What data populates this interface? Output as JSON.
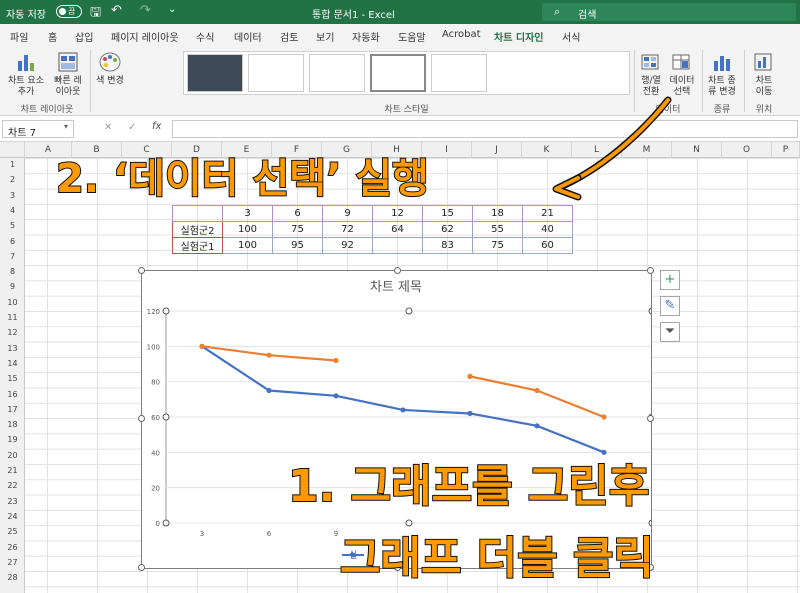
{
  "titlebar": {
    "autosave_label": "자동 저장",
    "autosave_state": "끔",
    "doc_title": "통합 문서1  -  Excel",
    "search_placeholder": "검색"
  },
  "menu": [
    "파일",
    "홈",
    "삽입",
    "페이지 레이아웃",
    "수식",
    "데이터",
    "검토",
    "보기",
    "자동화",
    "도움말",
    "Acrobat",
    "차트 디자인",
    "서식"
  ],
  "menu_active": "차트 디자인",
  "ribbon": {
    "add_element": "차트 요소\n추가",
    "quick_layout": "빠른 레\n이아웃",
    "group_layout": "차트 레이아웃",
    "change_color": "색 변경",
    "group_styles": "차트 스타일",
    "switch_rowcol": "행/열\n전환",
    "select_data": "데이터\n선택",
    "group_data": "데이터",
    "change_type": "차트 종\n류 변경",
    "group_type": "종류",
    "move_chart": "차트\n이동",
    "group_location": "위치"
  },
  "formula": {
    "name_box": "차트 7",
    "fx": "fx",
    "cancel": "✕",
    "enter": "✓"
  },
  "columns": [
    "A",
    "B",
    "C",
    "D",
    "E",
    "F",
    "G",
    "H",
    "I",
    "J",
    "K",
    "L",
    "M",
    "N",
    "O",
    "P"
  ],
  "rows": [
    "1",
    "2",
    "3",
    "4",
    "5",
    "6",
    "7",
    "8",
    "9",
    "10",
    "11",
    "12",
    "13",
    "14",
    "15",
    "16",
    "17",
    "18",
    "19",
    "20",
    "21",
    "22",
    "23",
    "24",
    "25",
    "26",
    "27",
    "28"
  ],
  "table": {
    "header": [
      "",
      "3",
      "6",
      "9",
      "12",
      "15",
      "18",
      "21"
    ],
    "rows": [
      [
        "실험군2",
        "100",
        "75",
        "72",
        "64",
        "62",
        "55",
        "40"
      ],
      [
        "실험군1",
        "100",
        "95",
        "92",
        "",
        "83",
        "75",
        "60"
      ]
    ]
  },
  "chart_data": {
    "type": "line",
    "title": "차트 제목",
    "x": [
      3,
      6,
      9,
      12,
      15,
      18,
      21
    ],
    "x_tick_labels": [
      "3",
      "6",
      "9"
    ],
    "ylim": [
      0,
      120
    ],
    "y_ticks": [
      0,
      20,
      40,
      60,
      80,
      100,
      120
    ],
    "series": [
      {
        "name": "실험군2",
        "color": "#4472c4",
        "values": [
          100,
          75,
          72,
          64,
          62,
          55,
          40
        ]
      },
      {
        "name": "실험군1",
        "color": "#ed7d31",
        "values": [
          100,
          95,
          92,
          null,
          83,
          75,
          60
        ]
      }
    ],
    "legend_visible_fragment": "실"
  },
  "annotations": {
    "step2": "2. ‘데이터 선택’ 실행",
    "step1_line1": "1. 그래프를 그린후",
    "step1_line2": "그래프 더블 클릭"
  },
  "colors": {
    "excel_green": "#217346",
    "annotation": "#ff9900"
  }
}
